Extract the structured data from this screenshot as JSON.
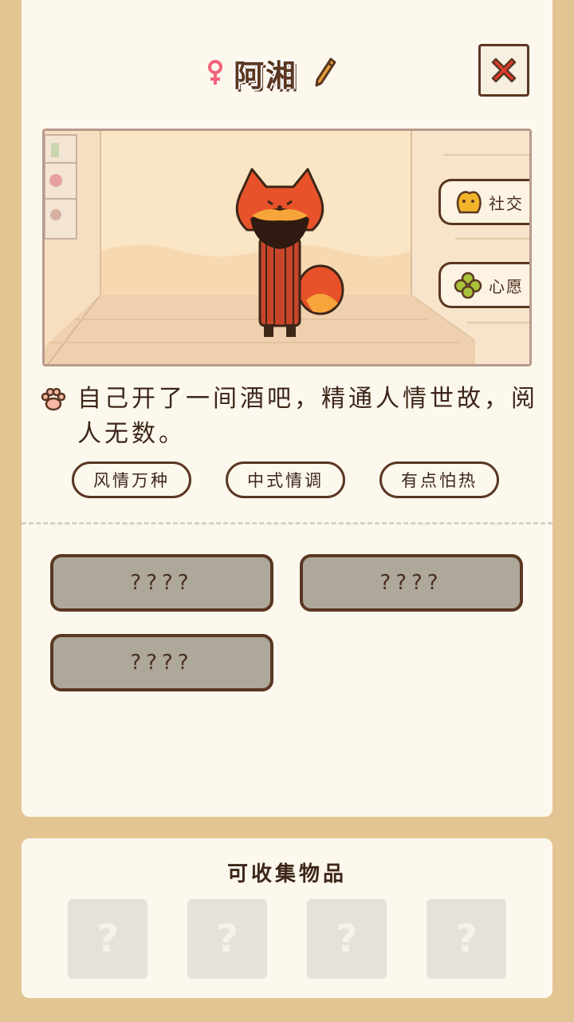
{
  "header": {
    "name": "阿湘",
    "gender_icon": "female-icon",
    "edit_icon": "pencil-icon",
    "close_icon": "close-x-icon"
  },
  "scene": {
    "buttons": [
      {
        "label": "社交",
        "icon": "social-icon"
      },
      {
        "label": "心愿",
        "icon": "clover-icon"
      }
    ]
  },
  "description": {
    "icon": "paw-icon",
    "text": "自己开了一间酒吧，精通人情世故，阅人无数。"
  },
  "tags": [
    "风情万种",
    "中式情调",
    "有点怕热"
  ],
  "locked_slots": [
    "????",
    "????",
    "????"
  ],
  "collectibles": {
    "title": "可收集物品",
    "items": [
      "?",
      "?",
      "?",
      "?"
    ]
  },
  "colors": {
    "background": "#e3c593",
    "card": "#fdf8ee",
    "border_brown": "#5a3722",
    "close_red": "#e23a2e",
    "locked_gray": "#aea89b",
    "fox_orange": "#e8522a"
  }
}
